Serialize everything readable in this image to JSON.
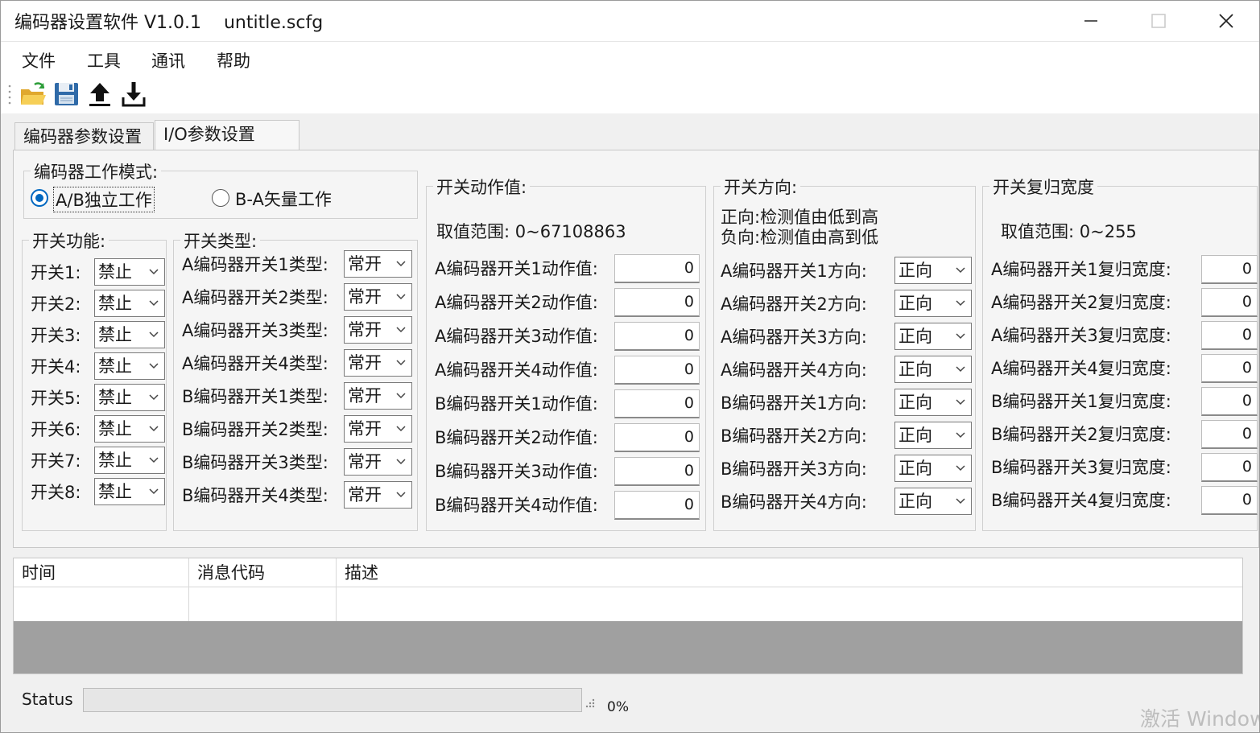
{
  "window": {
    "title": "编码器设置软件 V1.0.1    untitle.scfg"
  },
  "menu": [
    "文件",
    "工具",
    "通讯",
    "帮助"
  ],
  "toolbar": {
    "icons": [
      "open-folder-icon",
      "save-icon",
      "upload-icon",
      "download-icon"
    ]
  },
  "tabs": [
    {
      "label": "编码器参数设置"
    },
    {
      "label": "I/O参数设置"
    }
  ],
  "mode": {
    "title": "编码器工作模式:",
    "options": [
      {
        "label": "A/B独立工作",
        "selected": true
      },
      {
        "label": "B-A矢量工作",
        "selected": false
      }
    ]
  },
  "switch_function": {
    "title": "开关功能:",
    "rows": [
      {
        "label": "开关1:",
        "value": "禁止"
      },
      {
        "label": "开关2:",
        "value": "禁止"
      },
      {
        "label": "开关3:",
        "value": "禁止"
      },
      {
        "label": "开关4:",
        "value": "禁止"
      },
      {
        "label": "开关5:",
        "value": "禁止"
      },
      {
        "label": "开关6:",
        "value": "禁止"
      },
      {
        "label": "开关7:",
        "value": "禁止"
      },
      {
        "label": "开关8:",
        "value": "禁止"
      }
    ]
  },
  "switch_type": {
    "title": "开关类型:",
    "rows": [
      {
        "label": "A编码器开关1类型:",
        "value": "常开"
      },
      {
        "label": "A编码器开关2类型:",
        "value": "常开"
      },
      {
        "label": "A编码器开关3类型:",
        "value": "常开"
      },
      {
        "label": "A编码器开关4类型:",
        "value": "常开"
      },
      {
        "label": "B编码器开关1类型:",
        "value": "常开"
      },
      {
        "label": "B编码器开关2类型:",
        "value": "常开"
      },
      {
        "label": "B编码器开关3类型:",
        "value": "常开"
      },
      {
        "label": "B编码器开关4类型:",
        "value": "常开"
      }
    ]
  },
  "switch_action": {
    "title": "开关动作值:",
    "range": "取值范围: 0~67108863",
    "rows": [
      {
        "label": "A编码器开关1动作值:",
        "value": "0"
      },
      {
        "label": "A编码器开关2动作值:",
        "value": "0"
      },
      {
        "label": "A编码器开关3动作值:",
        "value": "0"
      },
      {
        "label": "A编码器开关4动作值:",
        "value": "0"
      },
      {
        "label": "B编码器开关1动作值:",
        "value": "0"
      },
      {
        "label": "B编码器开关2动作值:",
        "value": "0"
      },
      {
        "label": "B编码器开关3动作值:",
        "value": "0"
      },
      {
        "label": "B编码器开关4动作值:",
        "value": "0"
      }
    ]
  },
  "switch_direction": {
    "title": "开关方向:",
    "note1": "正向:检测值由低到高",
    "note2": "负向:检测值由高到低",
    "rows": [
      {
        "label": "A编码器开关1方向:",
        "value": "正向"
      },
      {
        "label": "A编码器开关2方向:",
        "value": "正向"
      },
      {
        "label": "A编码器开关3方向:",
        "value": "正向"
      },
      {
        "label": "A编码器开关4方向:",
        "value": "正向"
      },
      {
        "label": "B编码器开关1方向:",
        "value": "正向"
      },
      {
        "label": "B编码器开关2方向:",
        "value": "正向"
      },
      {
        "label": "B编码器开关3方向:",
        "value": "正向"
      },
      {
        "label": "B编码器开关4方向:",
        "value": "正向"
      }
    ]
  },
  "switch_reset": {
    "title": "开关复归宽度",
    "range": "取值范围: 0~255",
    "rows": [
      {
        "label": "A编码器开关1复归宽度:",
        "value": "0"
      },
      {
        "label": "A编码器开关2复归宽度:",
        "value": "0"
      },
      {
        "label": "A编码器开关3复归宽度:",
        "value": "0"
      },
      {
        "label": "A编码器开关4复归宽度:",
        "value": "0"
      },
      {
        "label": "B编码器开关1复归宽度:",
        "value": "0"
      },
      {
        "label": "B编码器开关2复归宽度:",
        "value": "0"
      },
      {
        "label": "B编码器开关3复归宽度:",
        "value": "0"
      },
      {
        "label": "B编码器开关4复归宽度:",
        "value": "0"
      }
    ]
  },
  "log": {
    "columns": [
      "时间",
      "消息代码",
      "描述"
    ]
  },
  "status": {
    "label": "Status",
    "progress_text": "0%",
    "progress_value": 0
  },
  "watermark": "激活 Window",
  "colors": {
    "accent": "#0067c0",
    "log_background": "#a0a0a0"
  }
}
